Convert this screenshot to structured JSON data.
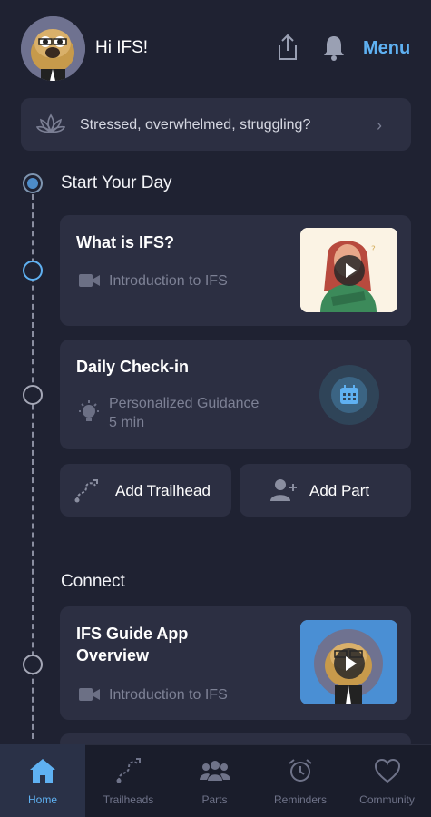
{
  "header": {
    "greeting": "Hi IFS!",
    "menu_label": "Menu",
    "share_icon": "share-icon",
    "bell_icon": "bell-icon"
  },
  "banner": {
    "text": "Stressed, overwhelmed, struggling?",
    "chevron": "›"
  },
  "sections": {
    "start_day": "Start Your Day",
    "connect": "Connect"
  },
  "cards": {
    "what_is_ifs": {
      "title": "What is IFS?",
      "subtitle": "Introduction to IFS"
    },
    "daily_checkin": {
      "title": "Daily Check-in",
      "subtitle": "Personalized Guidance",
      "duration": "5 min"
    },
    "guide_overview": {
      "title_line1": "IFS Guide App",
      "title_line2": "Overview",
      "subtitle": "Introduction to IFS"
    }
  },
  "actions": {
    "add_trailhead": "Add Trailhead",
    "add_part": "Add Part"
  },
  "nav": {
    "items": [
      {
        "label": "Home",
        "icon": "home-icon",
        "active": true
      },
      {
        "label": "Trailheads",
        "icon": "trailhead-icon",
        "active": false
      },
      {
        "label": "Parts",
        "icon": "parts-icon",
        "active": false
      },
      {
        "label": "Reminders",
        "icon": "alarm-clock-icon",
        "active": false
      },
      {
        "label": "Community",
        "icon": "heart-icon",
        "active": false
      }
    ]
  },
  "colors": {
    "background": "#1f2232",
    "card": "#2c2f42",
    "accent": "#5fb1f2"
  }
}
